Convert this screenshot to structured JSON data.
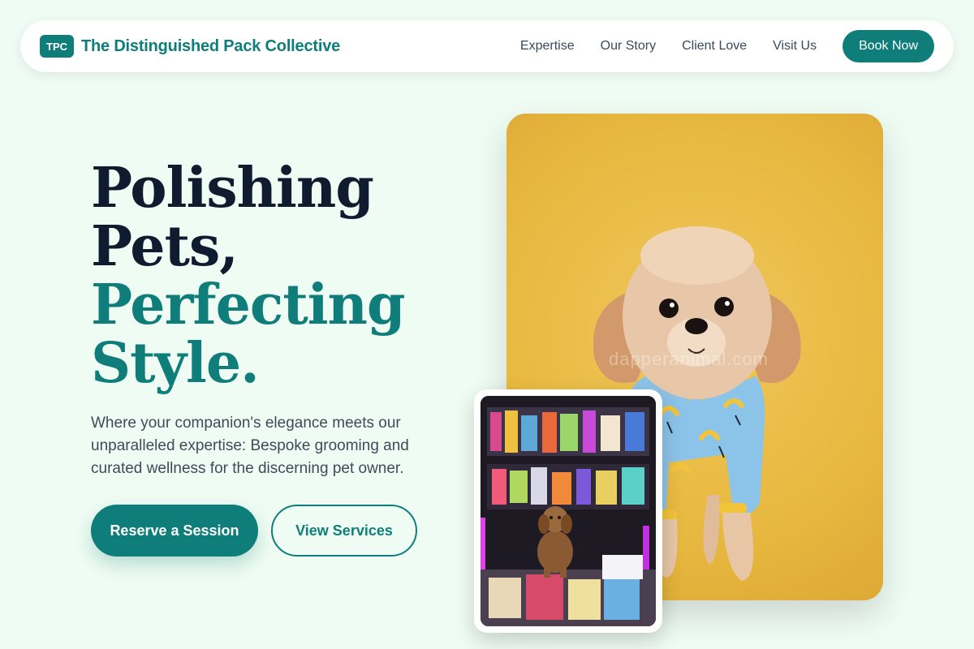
{
  "nav": {
    "logo_badge": "TPC",
    "brand_name": "The Distinguished Pack Collective",
    "links": [
      "Expertise",
      "Our Story",
      "Client Love",
      "Visit Us"
    ],
    "cta": "Book Now"
  },
  "hero": {
    "title_line1": "Polishing",
    "title_line2": "Pets,",
    "title_line3": "Perfecting",
    "title_line4": "Style.",
    "subtitle": "Where your companion's elegance meets our unparalleled expertise: Bespoke grooming and curated wellness for the discerning pet owner.",
    "primary_button": "Reserve a Session",
    "secondary_button": "View Services"
  },
  "images": {
    "main_watermark": "dapperanimal.com"
  },
  "colors": {
    "accent": "#0f7e7b",
    "heading_dark": "#0f1b2e",
    "background": "#effcf3"
  }
}
